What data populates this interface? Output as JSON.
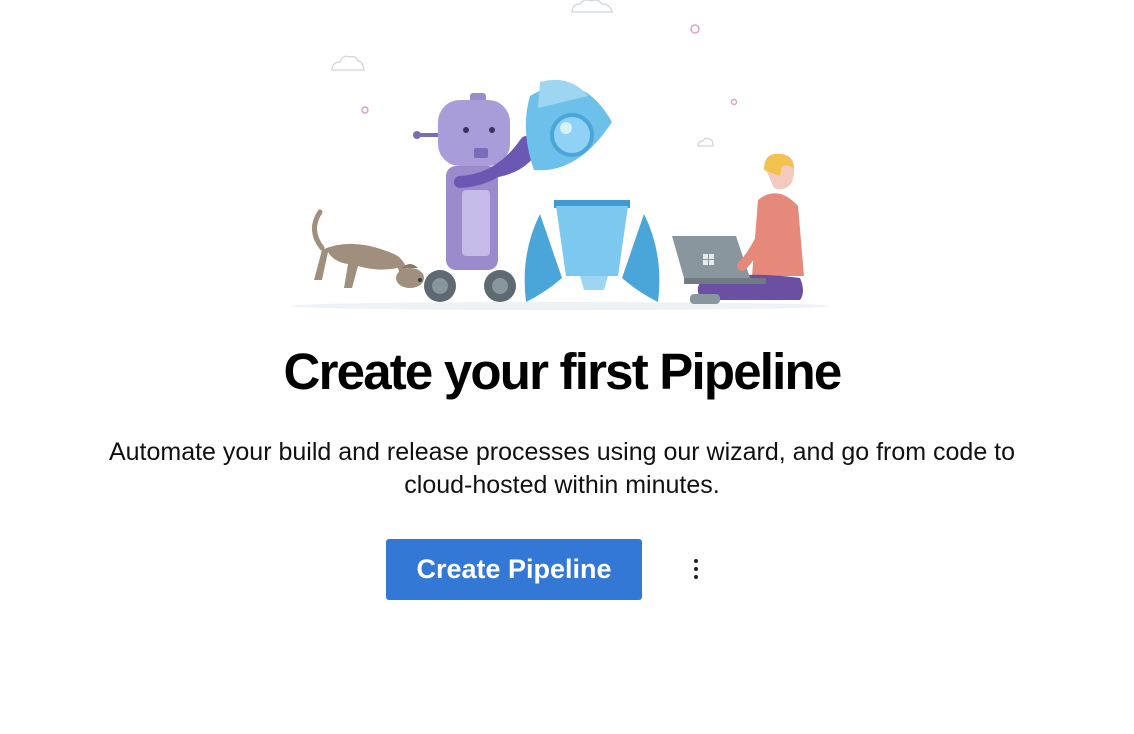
{
  "hero": {
    "illustration": "robot-dog-rocket-developer-illustration"
  },
  "main": {
    "title": "Create your first Pipeline",
    "description": "Automate your build and release processes using our wizard, and go from code to cloud-hosted within minutes.",
    "primary_button_label": "Create Pipeline",
    "more_options_icon": "more-vertical-icon"
  },
  "colors": {
    "primary_button": "#3478d6",
    "robot": "#9a8ccc",
    "rocket": "#5fb3e6",
    "dog": "#a08f7c",
    "person_shirt": "#e58a7a",
    "person_hair": "#f2c14e",
    "person_pants": "#6a4fa3"
  }
}
